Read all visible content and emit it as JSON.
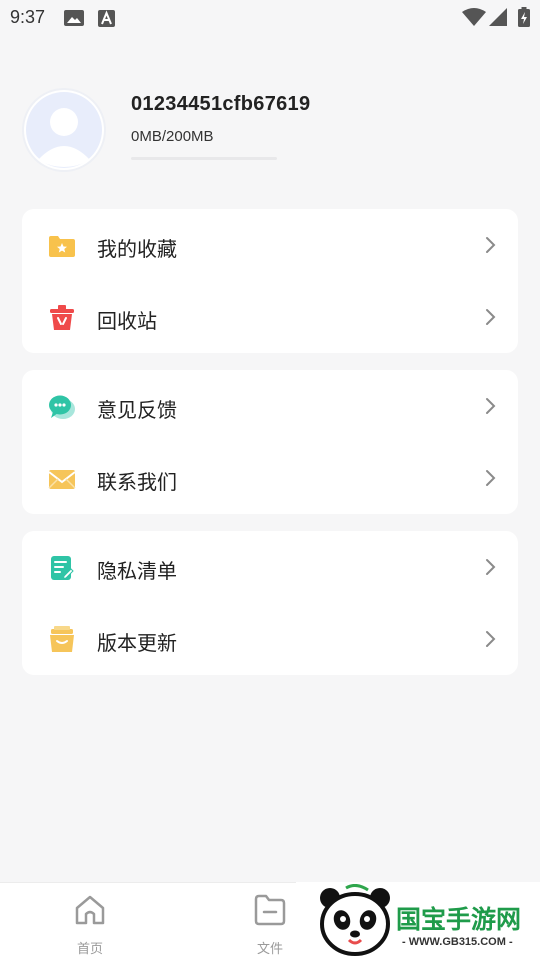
{
  "status_bar": {
    "time": "9:37"
  },
  "profile": {
    "user_id": "01234451cfb67619",
    "storage_text": "0MB/200MB",
    "storage_used_fraction": 0
  },
  "menu_groups": [
    {
      "items": [
        {
          "label": "我的收藏",
          "icon": "folder-star-icon"
        },
        {
          "label": "回收站",
          "icon": "trash-icon"
        }
      ]
    },
    {
      "items": [
        {
          "label": "意见反馈",
          "icon": "chat-bubble-icon"
        },
        {
          "label": "联系我们",
          "icon": "envelope-icon"
        }
      ]
    },
    {
      "items": [
        {
          "label": "隐私清单",
          "icon": "document-edit-icon"
        },
        {
          "label": "版本更新",
          "icon": "box-icon"
        }
      ]
    }
  ],
  "tabbar": {
    "tabs": [
      {
        "label": "首页",
        "icon": "home-icon"
      },
      {
        "label": "文件",
        "icon": "file-icon"
      }
    ]
  },
  "watermark": {
    "brand": "国宝手游网",
    "url": "- WWW.GB315.COM -"
  }
}
